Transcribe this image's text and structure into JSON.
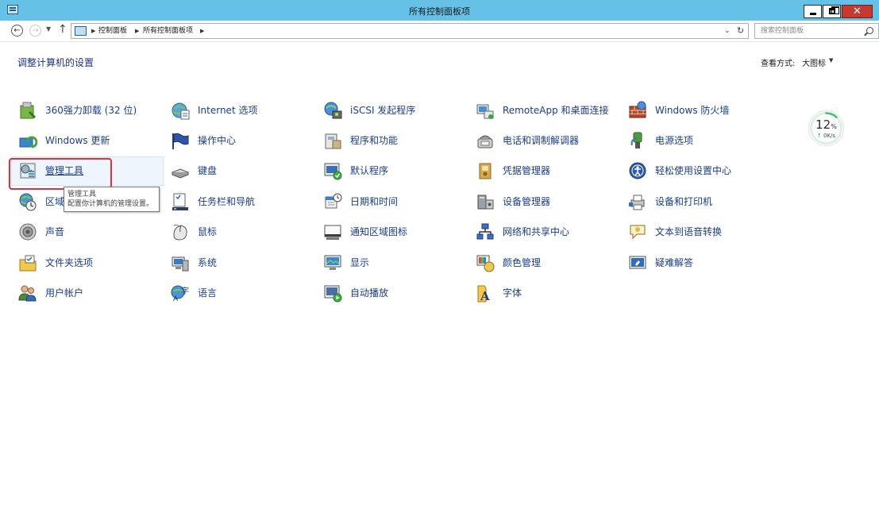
{
  "window": {
    "title": "所有控制面板项"
  },
  "address": {
    "breadcrumb": [
      "控制面板",
      "所有控制面板项"
    ],
    "search_placeholder": "搜索控制面板"
  },
  "heading": "调整计算机的设置",
  "view_by": {
    "label": "查看方式:",
    "value": "大图标"
  },
  "items": [
    {
      "label": "360强力卸载 (32 位)",
      "icon": "uninstall-icon"
    },
    {
      "label": "Internet 选项",
      "icon": "internet-options-icon"
    },
    {
      "label": "iSCSI 发起程序",
      "icon": "iscsi-icon"
    },
    {
      "label": "RemoteApp 和桌面连接",
      "icon": "remoteapp-icon"
    },
    {
      "label": "Windows 防火墙",
      "icon": "firewall-icon"
    },
    {
      "label": "Windows 更新",
      "icon": "windows-update-icon"
    },
    {
      "label": "操作中心",
      "icon": "action-center-flag-icon"
    },
    {
      "label": "程序和功能",
      "icon": "programs-icon"
    },
    {
      "label": "电话和调制解调器",
      "icon": "phone-icon"
    },
    {
      "label": "电源选项",
      "icon": "power-icon"
    },
    {
      "label": "管理工具",
      "icon": "admin-tools-icon"
    },
    {
      "label": "键盘",
      "icon": "keyboard-icon"
    },
    {
      "label": "默认程序",
      "icon": "default-programs-icon"
    },
    {
      "label": "凭据管理器",
      "icon": "credential-icon"
    },
    {
      "label": "轻松使用设置中心",
      "icon": "ease-of-access-icon"
    },
    {
      "label": "区域",
      "icon": "region-globe-icon"
    },
    {
      "label": "任务栏和导航",
      "icon": "taskbar-icon"
    },
    {
      "label": "日期和时间",
      "icon": "date-time-icon"
    },
    {
      "label": "设备管理器",
      "icon": "device-manager-icon"
    },
    {
      "label": "设备和打印机",
      "icon": "printer-icon"
    },
    {
      "label": "声音",
      "icon": "speaker-icon"
    },
    {
      "label": "鼠标",
      "icon": "mouse-icon"
    },
    {
      "label": "通知区域图标",
      "icon": "notification-icon"
    },
    {
      "label": "网络和共享中心",
      "icon": "network-icon"
    },
    {
      "label": "文本到语音转换",
      "icon": "speech-icon"
    },
    {
      "label": "文件夹选项",
      "icon": "folder-options-icon"
    },
    {
      "label": "系统",
      "icon": "system-icon"
    },
    {
      "label": "显示",
      "icon": "display-icon"
    },
    {
      "label": "颜色管理",
      "icon": "color-management-icon"
    },
    {
      "label": "疑难解答",
      "icon": "troubleshooting-icon"
    },
    {
      "label": "用户帐户",
      "icon": "user-accounts-icon"
    },
    {
      "label": "语言",
      "icon": "language-icon"
    },
    {
      "label": "自动播放",
      "icon": "autoplay-icon"
    },
    {
      "label": "字体",
      "icon": "fonts-icon"
    }
  ],
  "tooltip": {
    "title": "管理工具",
    "description": "配置你计算机的管理设置。"
  },
  "gauge": {
    "percent": 12,
    "percent_unit": "%",
    "speed": "0K/s"
  },
  "colors": {
    "titlebar": "#65c1e6",
    "link": "#1a3d8f",
    "highlight_box": "#e0303a",
    "gauge_ring": "#3cc06a"
  }
}
